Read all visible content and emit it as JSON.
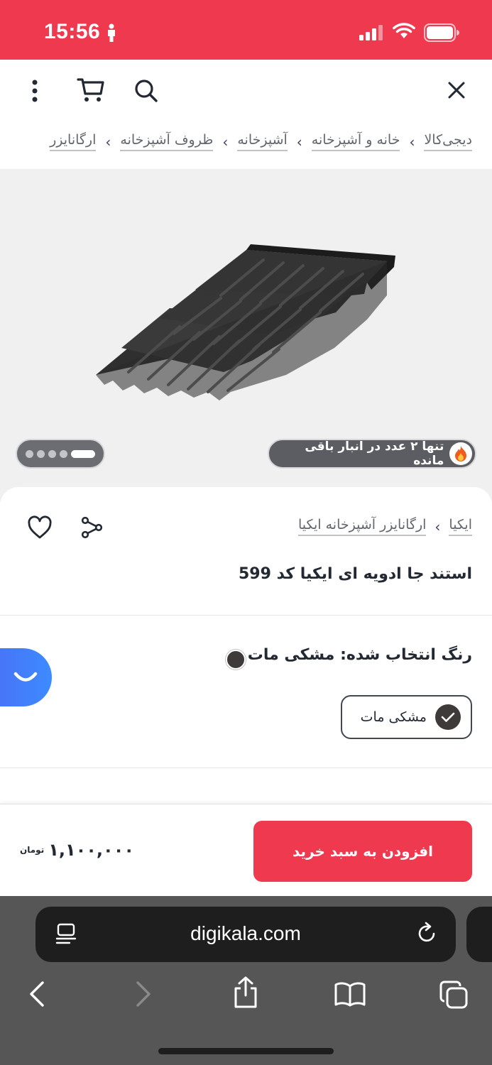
{
  "status_bar": {
    "time": "15:56",
    "color": "#ef394e"
  },
  "toolbar": {
    "icons": [
      "close-icon",
      "search-icon",
      "cart-icon",
      "more-icon"
    ]
  },
  "breadcrumb": {
    "items": [
      "دیجی‌کالا",
      "خانه و آشپزخانه",
      "آشپزخانه",
      "ظروف آشپزخانه",
      "ارگانایزر"
    ],
    "separator": "‹"
  },
  "gallery": {
    "stock_notice": "تنها ۲ عدد در انبار باقی مانده",
    "dot_count": 5,
    "active_dot": 5
  },
  "product": {
    "brand": "ایکیا",
    "category": "ارگانایزر آشپزخانه ایکیا",
    "separator": "‹",
    "title": "استند جا ادویه ای ایکیا کد 599",
    "selected_color_label": "رنگ انتخاب شده: مشکی مات",
    "colors": [
      {
        "name": "مشکی مات",
        "hex": "#3f3a3a",
        "selected": true
      }
    ]
  },
  "buy_bar": {
    "button_label": "افزودن به سبد خرید",
    "price": "۱,۱۰۰,۰۰۰",
    "currency": "تومان",
    "accent": "#ef394e"
  },
  "browser": {
    "url": "digikala.com"
  }
}
